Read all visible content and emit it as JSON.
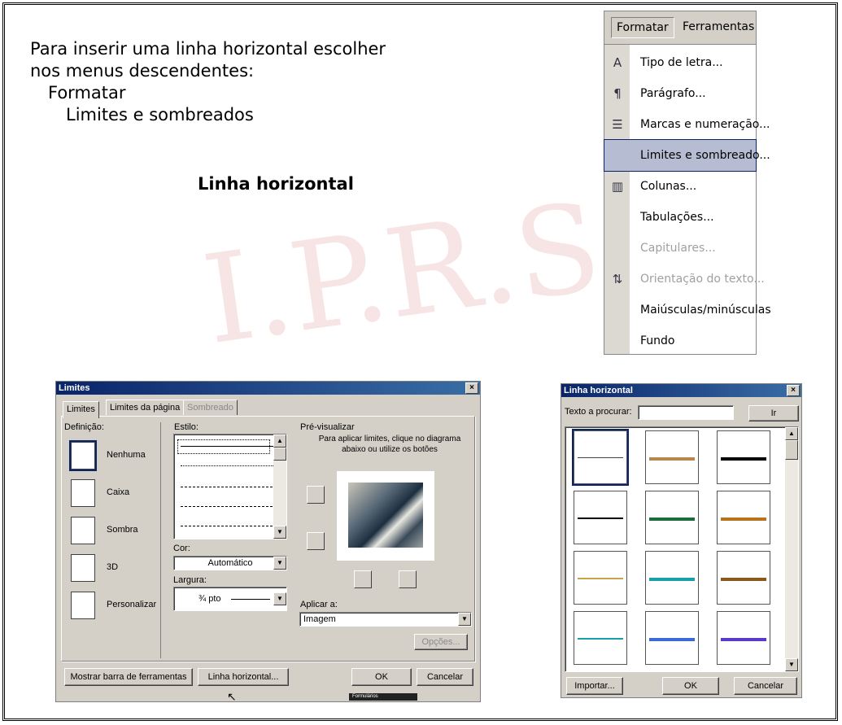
{
  "intro": {
    "line1": "Para inserir uma linha horizontal escolher",
    "line2": "nos menus descendentes:",
    "line3": "Formatar",
    "line4": "Limites e sombreados",
    "heading": "Linha horizontal"
  },
  "watermark": "I.P.R.S",
  "format_menu": {
    "bar": [
      "Formatar",
      "Ferramentas"
    ],
    "items": [
      {
        "label": "Tipo de letra...",
        "icon": "font-icon"
      },
      {
        "label": "Parágrafo...",
        "icon": "paragraph-icon"
      },
      {
        "label": "Marcas e numeração...",
        "icon": "bullets-icon"
      },
      {
        "label": "Limites e sombreado...",
        "icon": "",
        "selected": true
      },
      {
        "label": "Colunas...",
        "icon": "columns-icon"
      },
      {
        "label": "Tabulações...",
        "icon": ""
      },
      {
        "label": "Capitulares...",
        "icon": "",
        "disabled": true
      },
      {
        "label": "Orientação do texto...",
        "icon": "text-direction-icon",
        "disabled": true
      },
      {
        "label": "Maiúsculas/minúsculas",
        "icon": ""
      },
      {
        "label": "Fundo",
        "icon": ""
      }
    ]
  },
  "limites_dialog": {
    "title": "Limites",
    "close": "×",
    "tabs": [
      "Limites",
      "Limites da página",
      "Sombreado"
    ],
    "definicao_label": "Definição:",
    "definicoes": [
      "Nenhuma",
      "Caixa",
      "Sombra",
      "3D",
      "Personalizar"
    ],
    "estilo_label": "Estilo:",
    "cor_label": "Cor:",
    "cor_value": "Automático",
    "largura_label": "Largura:",
    "largura_value": "¾ pto",
    "preview_label": "Pré-visualizar",
    "preview_hint": "Para aplicar limites, clique no diagrama abaixo ou utilize os botões",
    "aplicar_label": "Aplicar a:",
    "aplicar_value": "Imagem",
    "opcoes_button": "Opções...",
    "mostrar_button": "Mostrar barra de ferramentas",
    "linha_button": "Linha horizontal...",
    "ok_button": "OK",
    "cancelar_button": "Cancelar",
    "formularios_label": "Formulários"
  },
  "linha_dialog": {
    "title": "Linha horizontal",
    "close": "×",
    "search_label": "Texto a procurar:",
    "search_value": "",
    "ir_button": "Ir",
    "importar_button": "Importar...",
    "ok_button": "OK",
    "cancelar_button": "Cancelar",
    "line_colors": [
      "#444444",
      "#b8864b",
      "#000000",
      "#000000",
      "#1c6b3a",
      "#b8741c",
      "#c9a34a",
      "#18a0a8",
      "#8a5a1c",
      "#18a0a8",
      "#3a6ad8",
      "#5a3ac8"
    ]
  }
}
